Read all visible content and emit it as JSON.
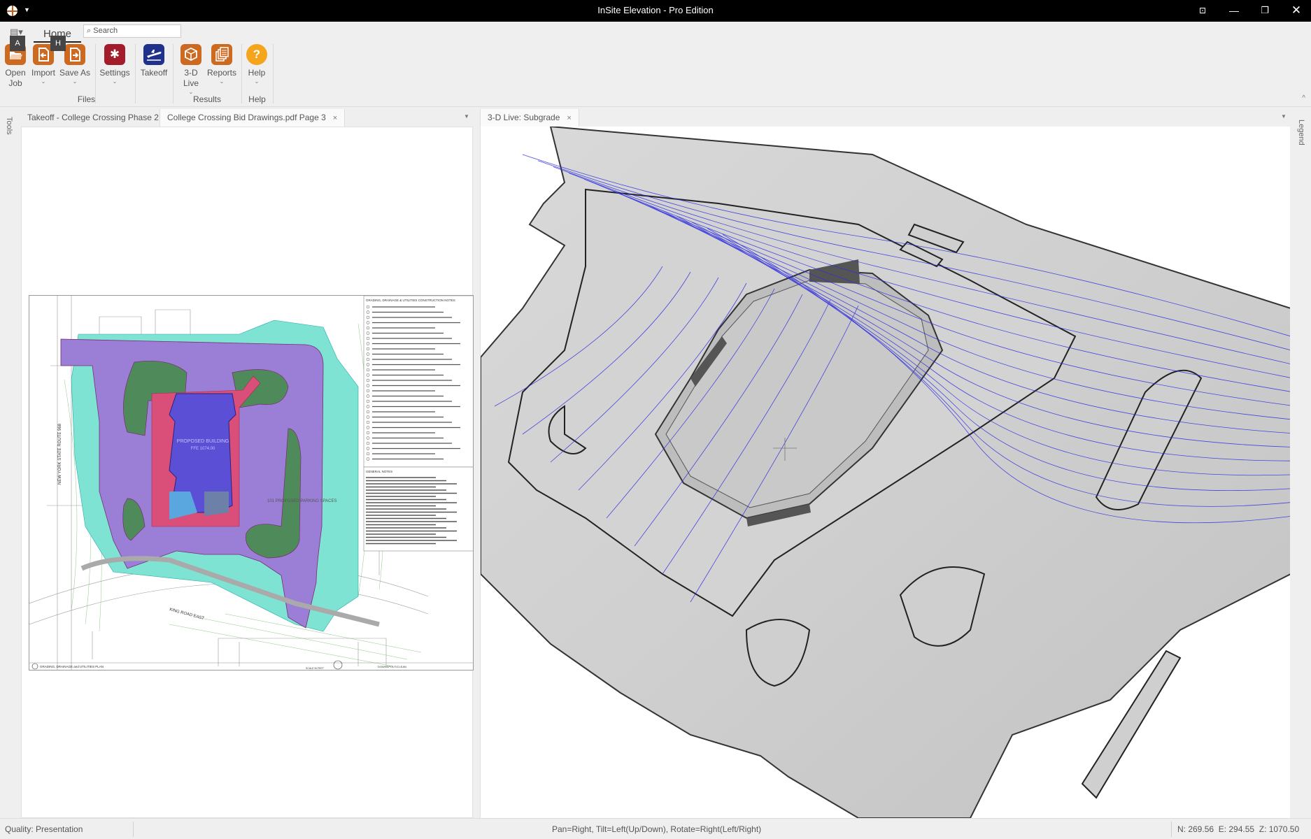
{
  "window": {
    "title": "InSite Elevation - Pro Edition",
    "controls": [
      "always-on-top",
      "minimize",
      "restore",
      "close"
    ]
  },
  "ribbon": {
    "tab": "Home",
    "search_placeholder": "Search",
    "keytips": {
      "app_menu": "A",
      "home": "H"
    },
    "groups": [
      {
        "label": "Files",
        "buttons": [
          {
            "label": "Open Job",
            "line1": "Open",
            "line2": "Job",
            "icon": "folder-open-icon"
          },
          {
            "label": "Import",
            "icon": "import-icon",
            "dropdown": true
          },
          {
            "label": "Save As",
            "icon": "save-as-icon",
            "dropdown": true
          },
          {
            "label": "Settings",
            "icon": "gear-icon",
            "dropdown": true
          },
          {
            "label": "Takeoff",
            "icon": "takeoff-plane-icon"
          }
        ]
      },
      {
        "label": "Results",
        "buttons": [
          {
            "label": "3-D Live",
            "line1": "3-D",
            "line2": "Live",
            "icon": "cube-icon",
            "dropdown": true
          },
          {
            "label": "Reports",
            "icon": "reports-icon",
            "dropdown": true
          }
        ]
      },
      {
        "label": "Help",
        "buttons": [
          {
            "label": "Help",
            "icon": "help-icon",
            "dropdown": true
          }
        ]
      }
    ],
    "caret": "⌄",
    "collapse": "^"
  },
  "side_tabs": {
    "left": "Tools",
    "right": "Legend"
  },
  "left_pane": {
    "tabs": [
      {
        "label": "Takeoff - College Crossing Phase 2",
        "active": false,
        "closable": false
      },
      {
        "label": "College Crossing Bid Drawings.pdf Page 3",
        "active": true,
        "closable": true
      }
    ],
    "drawing": {
      "sheet_title": "GRADING, DRAINAGE and UTILITIES PLAN",
      "notes_title": "GRADING, DRAINAGE & UTILITIES CONSTRUCTION NOTES",
      "general_notes_title": "GENERAL NOTES",
      "building_label": "PROPOSED BUILDING",
      "building_ffe": "FFE 1074.00",
      "parking_label": "101 PROPOSED PARKING SPACES",
      "road_label": "KING ROAD EAST",
      "route_label": "NEW YORK STATE ROUTE 968",
      "detail_label": "DOWNSPOUT/CLEAN",
      "scale_label": "SCALE IN FEET",
      "colors": {
        "site": "#9b7fd6",
        "buffer": "#7fe3d4",
        "green": "#4f8a5a",
        "building": "#5b4fd6",
        "pink": "#d94f7a"
      }
    }
  },
  "right_pane": {
    "tabs": [
      {
        "label": "3-D Live: Subgrade",
        "active": true,
        "closable": true
      }
    ],
    "contour_color": "#2d2de0"
  },
  "status": {
    "quality": "Quality: Presentation",
    "hint": "Pan=Right, Tilt=Left(Up/Down), Rotate=Right(Left/Right)",
    "coords": "N: 269.56  E: 294.55  Z: 1070.50"
  },
  "close_glyph": "×",
  "pane_menu_glyph": "▼"
}
